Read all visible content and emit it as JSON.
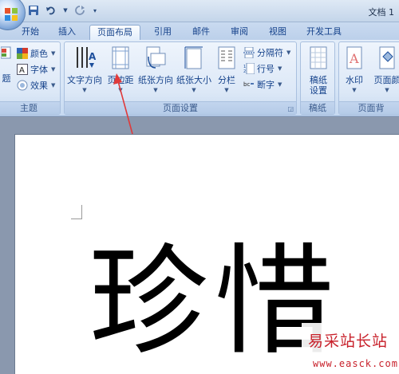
{
  "window": {
    "title": "文档 1"
  },
  "tabs": [
    {
      "label": "开始",
      "active": false
    },
    {
      "label": "插入",
      "active": false
    },
    {
      "label": "页面布局",
      "active": true
    },
    {
      "label": "引用",
      "active": false
    },
    {
      "label": "邮件",
      "active": false
    },
    {
      "label": "审阅",
      "active": false
    },
    {
      "label": "视图",
      "active": false
    },
    {
      "label": "开发工具",
      "active": false
    }
  ],
  "ribbon": {
    "theme": {
      "label": "主题",
      "partial_button": "题",
      "colors": "颜色",
      "fonts": "字体",
      "effects": "效果"
    },
    "page_setup": {
      "label": "页面设置",
      "text_direction": "文字方向",
      "margins": "页边距",
      "orientation": "纸张方向",
      "size": "纸张大小",
      "columns": "分栏",
      "breaks": "分隔符",
      "line_numbers": "行号",
      "hyphenation": "断字"
    },
    "manuscript": {
      "label": "稿纸",
      "settings_line1": "稿纸",
      "settings_line2": "设置"
    },
    "page_background": {
      "label": "页面背",
      "watermark": "水印",
      "page_color": "页面颜"
    }
  },
  "document": {
    "text": "珍惜"
  },
  "watermark": {
    "title": "易采站长站",
    "url": "www.easck.com"
  },
  "colors": {
    "pointer_arrow": "#e03a3a",
    "watermark_red": "#c8202a"
  }
}
